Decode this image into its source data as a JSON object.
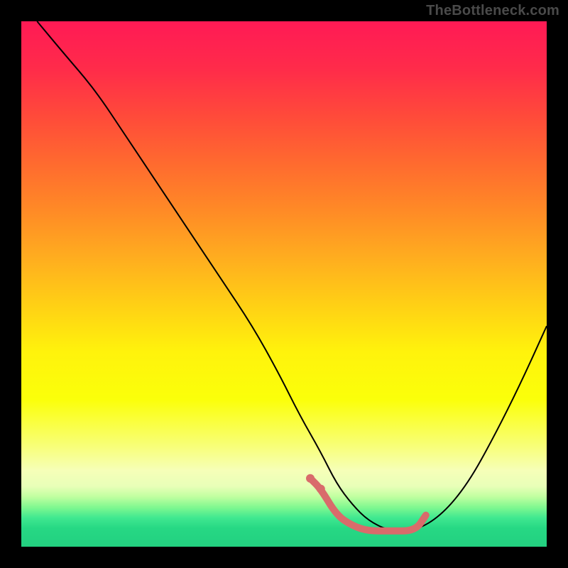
{
  "watermark": "TheBottleneck.com",
  "chart_data": {
    "type": "line",
    "title": "",
    "xlabel": "",
    "ylabel": "",
    "xlim": [
      0,
      100
    ],
    "ylim": [
      0,
      100
    ],
    "legend": false,
    "grid": false,
    "background_gradient": {
      "stops": [
        {
          "offset": 0.0,
          "color": "#ff1a55"
        },
        {
          "offset": 0.09,
          "color": "#ff2b4a"
        },
        {
          "offset": 0.18,
          "color": "#ff4a3a"
        },
        {
          "offset": 0.27,
          "color": "#ff6a2f"
        },
        {
          "offset": 0.36,
          "color": "#ff8a26"
        },
        {
          "offset": 0.45,
          "color": "#ffad1f"
        },
        {
          "offset": 0.54,
          "color": "#ffd015"
        },
        {
          "offset": 0.63,
          "color": "#fff30c"
        },
        {
          "offset": 0.72,
          "color": "#fbff0a"
        },
        {
          "offset": 0.81,
          "color": "#f8ff7a"
        },
        {
          "offset": 0.855,
          "color": "#f6ffb8"
        },
        {
          "offset": 0.885,
          "color": "#e8ffb8"
        },
        {
          "offset": 0.905,
          "color": "#c0ffa0"
        },
        {
          "offset": 0.925,
          "color": "#80f890"
        },
        {
          "offset": 0.945,
          "color": "#40e890"
        },
        {
          "offset": 0.965,
          "color": "#26d884"
        },
        {
          "offset": 1.0,
          "color": "#23d080"
        }
      ]
    },
    "series": [
      {
        "name": "bottleneck-curve",
        "color": "#000000",
        "width": 2,
        "x": [
          3,
          8,
          14,
          20,
          26,
          32,
          38,
          44,
          49,
          53,
          57,
          60,
          63,
          66,
          70,
          75,
          80,
          85,
          90,
          95,
          100
        ],
        "y": [
          100,
          94,
          87,
          78,
          69,
          60,
          51,
          42,
          33,
          25,
          18,
          12,
          8,
          5,
          3,
          3,
          6,
          12,
          21,
          31,
          42
        ]
      },
      {
        "name": "optimal-range-highlight",
        "color": "#d96b6b",
        "width": 10,
        "linecap": "round",
        "x": [
          55,
          57,
          60,
          63,
          66,
          70,
          75,
          77
        ],
        "y": [
          13,
          11,
          6,
          4,
          3,
          3,
          3,
          6
        ]
      }
    ],
    "markers": [
      {
        "name": "dot-1",
        "x": 55,
        "y": 13,
        "r": 6,
        "color": "#d96b6b"
      },
      {
        "name": "dot-2",
        "x": 57,
        "y": 11,
        "r": 6,
        "color": "#d96b6b"
      }
    ]
  }
}
